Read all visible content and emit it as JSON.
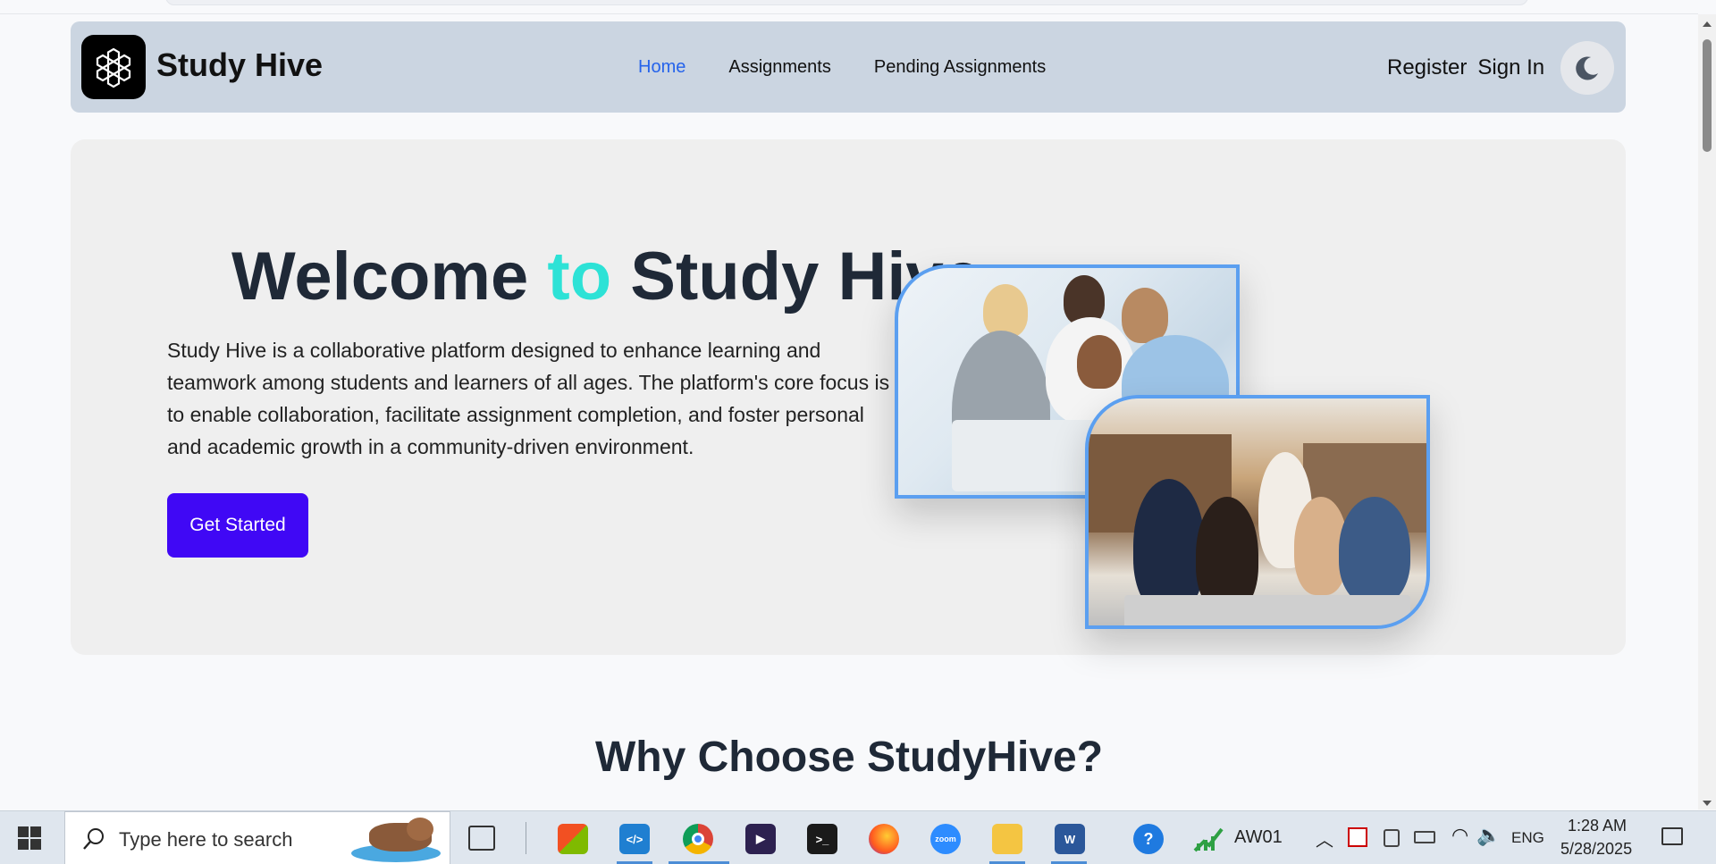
{
  "navbar": {
    "brand": "Study Hive",
    "links": [
      "Home",
      "Assignments",
      "Pending Assignments"
    ],
    "register": "Register",
    "signin": "Sign In"
  },
  "hero": {
    "title_part1": "Welcome ",
    "title_accent": "to",
    "title_part2": " Study Hive",
    "description": "Study Hive is a collaborative platform designed to enhance learning and teamwork among students and learners of all ages. The platform's core focus is to enable collaboration, facilitate assignment completion, and foster personal and academic growth in a community-driven environment.",
    "cta": "Get Started"
  },
  "section": {
    "title": "Why Choose StudyHive?"
  },
  "taskbar": {
    "search_placeholder": "Type here to search",
    "app_label": "AW01",
    "language": "ENG",
    "time": "1:28 AM",
    "date": "5/28/2025"
  },
  "colors": {
    "accent": "#2de2d6",
    "cta": "#4008f5",
    "nav_active": "#2563eb",
    "navbar_bg": "#cbd5e1"
  }
}
